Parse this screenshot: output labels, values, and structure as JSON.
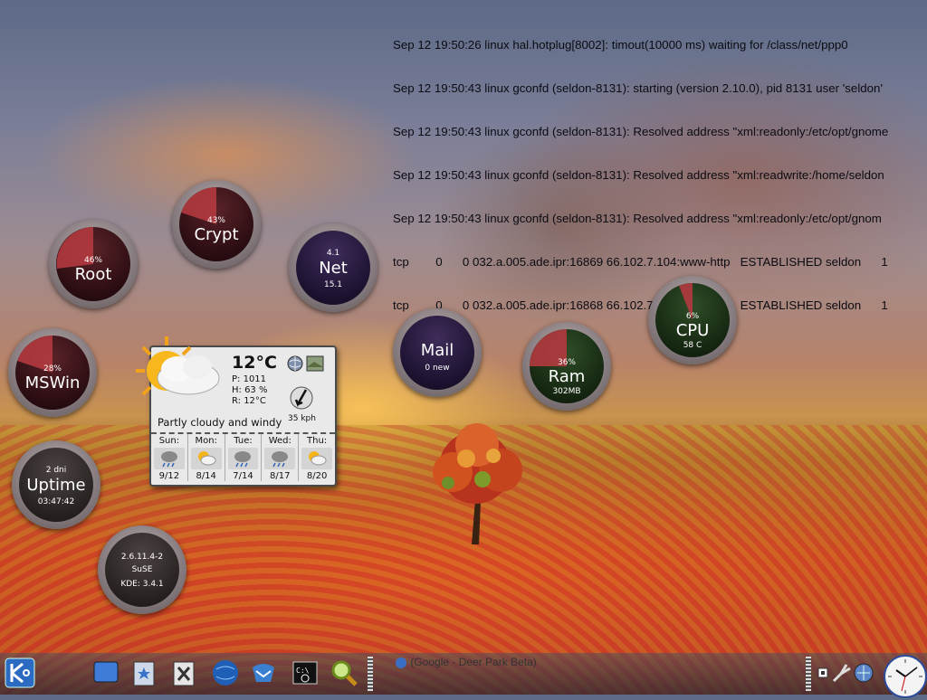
{
  "log_lines": [
    "Sep 12 19:50:26 linux hal.hotplug[8002]: timout(10000 ms) waiting for /class/net/ppp0",
    "Sep 12 19:50:43 linux gconfd (seldon-8131): starting (version 2.10.0), pid 8131 user 'seldon'",
    "Sep 12 19:50:43 linux gconfd (seldon-8131): Resolved address \"xml:readonly:/etc/opt/gnome",
    "Sep 12 19:50:43 linux gconfd (seldon-8131): Resolved address \"xml:readwrite:/home/seldon",
    "Sep 12 19:50:43 linux gconfd (seldon-8131): Resolved address \"xml:readonly:/etc/opt/gnom",
    "tcp        0      0 032.a.005.ade.ipr:16869 66.102.7.104:www-http   ESTABLISHED seldon      1",
    "tcp        0      0 032.a.005.ade.ipr:16868 66.102.7.104:www-http   ESTABLISHED seldon      1"
  ],
  "gauges": {
    "crypt": {
      "pct": "43%",
      "label": "Crypt"
    },
    "root": {
      "pct": "46%",
      "label": "Root"
    },
    "net": {
      "top": "4.1",
      "label": "Net",
      "bottom": "15.1"
    },
    "mswin": {
      "pct": "28%",
      "label": "MSWin"
    },
    "mail": {
      "label": "Mail",
      "bottom": "0 new"
    },
    "ram": {
      "pct": "36%",
      "label": "Ram",
      "bottom": "302MB"
    },
    "cpu": {
      "pct": "6%",
      "label": "CPU",
      "bottom": "58 C"
    },
    "uptime": {
      "top": "2 dni",
      "label": "Uptime",
      "bottom": "03:47:42"
    },
    "kernel": {
      "line1": "2.6.11.4-2",
      "line2": "SuSE",
      "line3": "KDE: 3.4.1"
    }
  },
  "weather": {
    "temp": "12°C",
    "pressure": "P: 1011",
    "humidity": "H: 63 %",
    "realfeel": "R: 12°C",
    "wind": "35 kph",
    "desc": "Partly cloudy and windy",
    "days": [
      {
        "name": "Sun:",
        "temps": "9/12",
        "icon": "rain-icon"
      },
      {
        "name": "Mon:",
        "temps": "8/14",
        "icon": "sun-cloud-icon"
      },
      {
        "name": "Tue:",
        "temps": "7/14",
        "icon": "rain-icon"
      },
      {
        "name": "Wed:",
        "temps": "8/17",
        "icon": "rain-icon"
      },
      {
        "name": "Thu:",
        "temps": "8/20",
        "icon": "sun-cloud-icon"
      }
    ]
  },
  "taskbar": {
    "task_label": "(Google - Deer Park Beta)",
    "launchers": [
      "kde-menu-icon",
      "desktop-icon",
      "bookmarks-icon",
      "x-window-icon",
      "globe-browser-icon",
      "thunderbird-icon",
      "terminal-icon",
      "search-magnifier-icon"
    ]
  }
}
